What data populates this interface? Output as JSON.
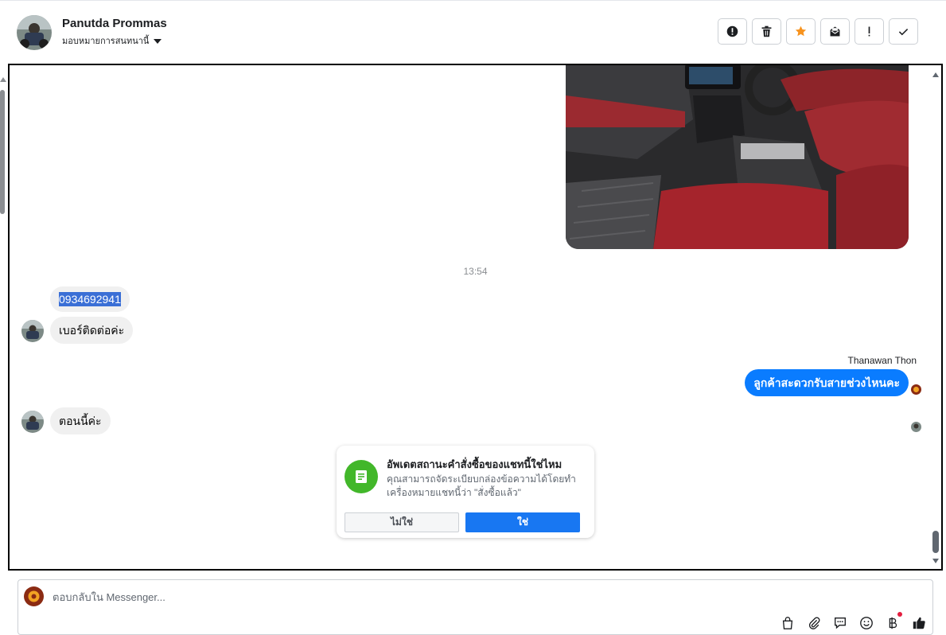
{
  "header": {
    "contact_name": "Panutda Prommas",
    "assign_label": "มอบหมายการสนทนานี้",
    "toolbar": {
      "buttons": [
        "spam-icon",
        "trash-icon",
        "star-icon",
        "mark-unread-icon",
        "follow-up-icon",
        "done-icon"
      ],
      "star_color": "#f7931e"
    }
  },
  "chat": {
    "timestamp": "13:54",
    "messages": [
      {
        "text": "0934692941",
        "highlighted": true
      },
      {
        "text": "เบอร์ติดต่อค่ะ"
      },
      {
        "sender": "Thanawan Thon",
        "text": "ลูกค้าสะดวกรับสายช่วงไหนคะ",
        "outgoing": true
      },
      {
        "text": "ตอนนี้ค่ะ"
      }
    ],
    "accent_color": "#0a7cff"
  },
  "prompt": {
    "title": "อัพเดตสถานะคำสั่งซื้อของแชทนี้ใช่ไหม",
    "body": "คุณสามารถจัดระเบียบกล่องข้อความได้โดยทำเครื่องหมายแชทนี้ว่า \"สั่งซื้อแล้ว\"",
    "no_label": "ไม่ใช่",
    "yes_label": "ใช่",
    "icon": "order-icon",
    "icon_color": "#42b72a"
  },
  "composer": {
    "placeholder": "ตอบกลับใน Messenger...",
    "icons": [
      "shopping-bag-icon",
      "attachment-icon",
      "saved-reply-icon",
      "emoji-icon",
      "baht-icon",
      "like-icon"
    ]
  }
}
